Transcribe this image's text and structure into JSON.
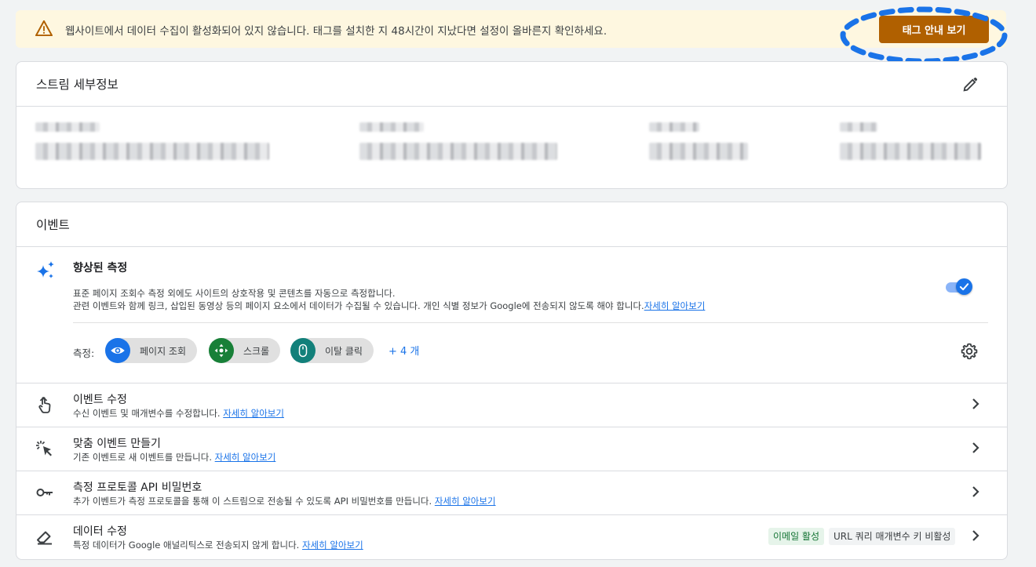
{
  "banner": {
    "icon": "warning-icon",
    "message": "웹사이트에서 데이터 수집이 활성화되어 있지 않습니다. 태그를 설치한 지 48시간이 지났다면 설정이 올바른지 확인하세요.",
    "button_label": "태그 안내 보기",
    "accent_color": "#b06000",
    "highlight_color": "#1a73e8"
  },
  "stream_details": {
    "title": "스트림 세부정보",
    "edit_icon": "pencil-icon"
  },
  "events": {
    "title": "이벤트",
    "enhanced": {
      "icon": "sparkle-icon",
      "title": "향상된 측정",
      "desc_line1": "표준 페이지 조회수 측정 외에도 사이트의 상호작용 및 콘텐츠를 자동으로 측정합니다.",
      "desc_line2": "관련 이벤트와 함께 링크, 삽입된 동영상 등의 페이지 요소에서 데이터가 수집될 수 있습니다. 개인 식별 정보가 Google에 전송되지 않도록 해야 합니다.",
      "learn_more": "자세히 알아보기",
      "toggle_on": true,
      "measure_label": "측정:",
      "chips": [
        {
          "label": "페이지 조회",
          "icon": "eye-icon",
          "color": "#1a73e8"
        },
        {
          "label": "스크롤",
          "icon": "scroll-crosshair-icon",
          "color": "#188038"
        },
        {
          "label": "이탈 클릭",
          "icon": "mouse-icon",
          "color": "#12807a"
        }
      ],
      "more": "+ 4 개",
      "settings_icon": "gear-icon"
    },
    "rows": [
      {
        "icon": "touch-hand-icon",
        "title": "이벤트 수정",
        "desc": "수신 이벤트 및 매개변수를 수정합니다.",
        "learn_more": "자세히 알아보기"
      },
      {
        "icon": "click-sparkle-icon",
        "title": "맞춤 이벤트 만들기",
        "desc": "기존 이벤트로 새 이벤트를 만듭니다.",
        "learn_more": "자세히 알아보기"
      },
      {
        "icon": "key-icon",
        "title": "측정 프로토콜 API 비밀번호",
        "desc": "추가 이벤트가 측정 프로토콜을 통해 이 스트림으로 전송될 수 있도록 API 비밀번호를 만듭니다.",
        "learn_more": "자세히 알아보기"
      },
      {
        "icon": "eraser-icon",
        "title": "데이터 수정",
        "desc": "특정 데이터가 Google 애널리틱스로 전송되지 않게 합니다.",
        "learn_more": "자세히 알아보기",
        "badge_active": "이메일 활성",
        "badge_inactive": "URL 쿼리 매개변수 키 비활성"
      }
    ]
  }
}
